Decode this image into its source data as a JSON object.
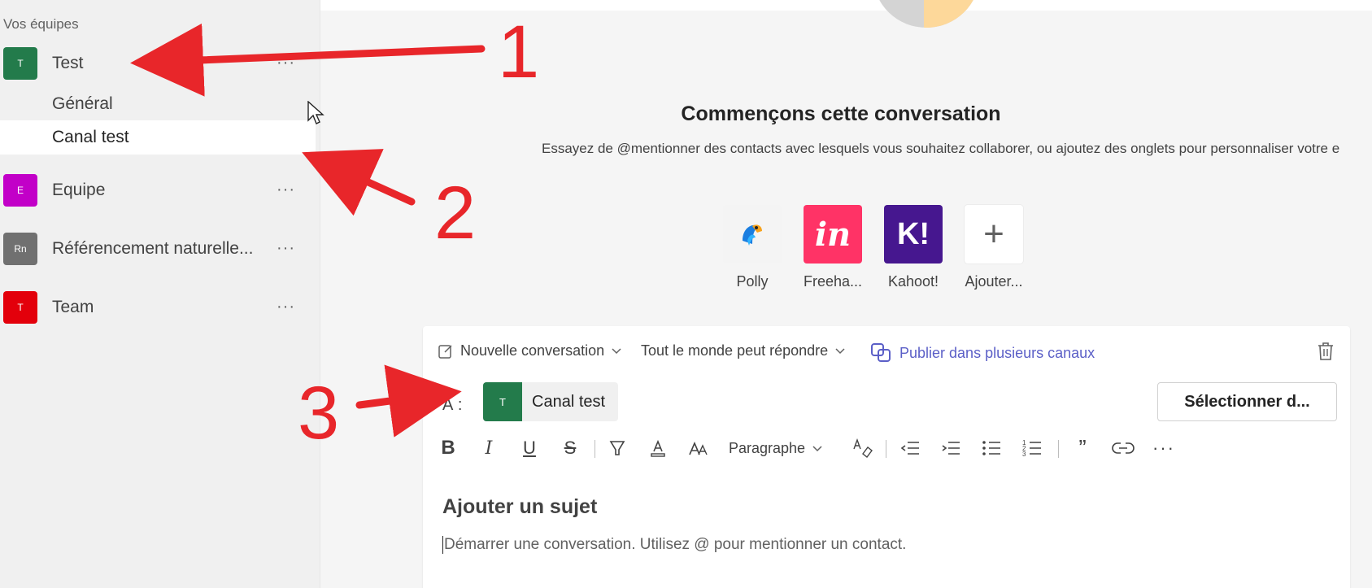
{
  "sidebar": {
    "heading": "Vos équipes",
    "teams": [
      {
        "initial": "T",
        "name": "Test",
        "color": "#237b4b"
      },
      {
        "initial": "E",
        "name": "Equipe",
        "color": "#c200c8"
      },
      {
        "initial": "Rn",
        "name": "Référencement naturelle...",
        "color": "#707070"
      },
      {
        "initial": "T",
        "name": "Team",
        "color": "#e3000b"
      }
    ],
    "channels": [
      {
        "label": "Général"
      },
      {
        "label": "Canal test",
        "active": true
      }
    ],
    "more_glyph": "···"
  },
  "main": {
    "title": "Commençons cette conversation",
    "subtitle": "Essayez de @mentionner des contacts avec lesquels vous souhaitez collaborer, ou ajoutez des onglets pour personnaliser votre e",
    "apps": [
      {
        "name": "Polly",
        "icon": "polly-icon"
      },
      {
        "name": "Freeha...",
        "icon": "invision-icon",
        "tile_text": "in",
        "color": "#ff3366"
      },
      {
        "name": "Kahoot!",
        "icon": "kahoot-icon",
        "tile_text": "K!",
        "color": "#46178f"
      },
      {
        "name": "Ajouter...",
        "icon": "plus-icon",
        "tile_text": "+"
      }
    ]
  },
  "compose": {
    "new_conversation": "Nouvelle conversation",
    "reply_setting": "Tout le monde peut répondre",
    "publish": "Publier dans plusieurs canaux",
    "to_label": "À :",
    "chip_initial": "T",
    "chip_label": "Canal test",
    "select_button": "Sélectionner d...",
    "paragraph": "Paragraphe",
    "subject_placeholder": "Ajouter un sujet",
    "body_placeholder": "Démarrer une conversation. Utilisez @ pour mentionner un contact."
  },
  "annotations": {
    "one": "1",
    "two": "2",
    "three": "3",
    "color": "#e8262a"
  }
}
